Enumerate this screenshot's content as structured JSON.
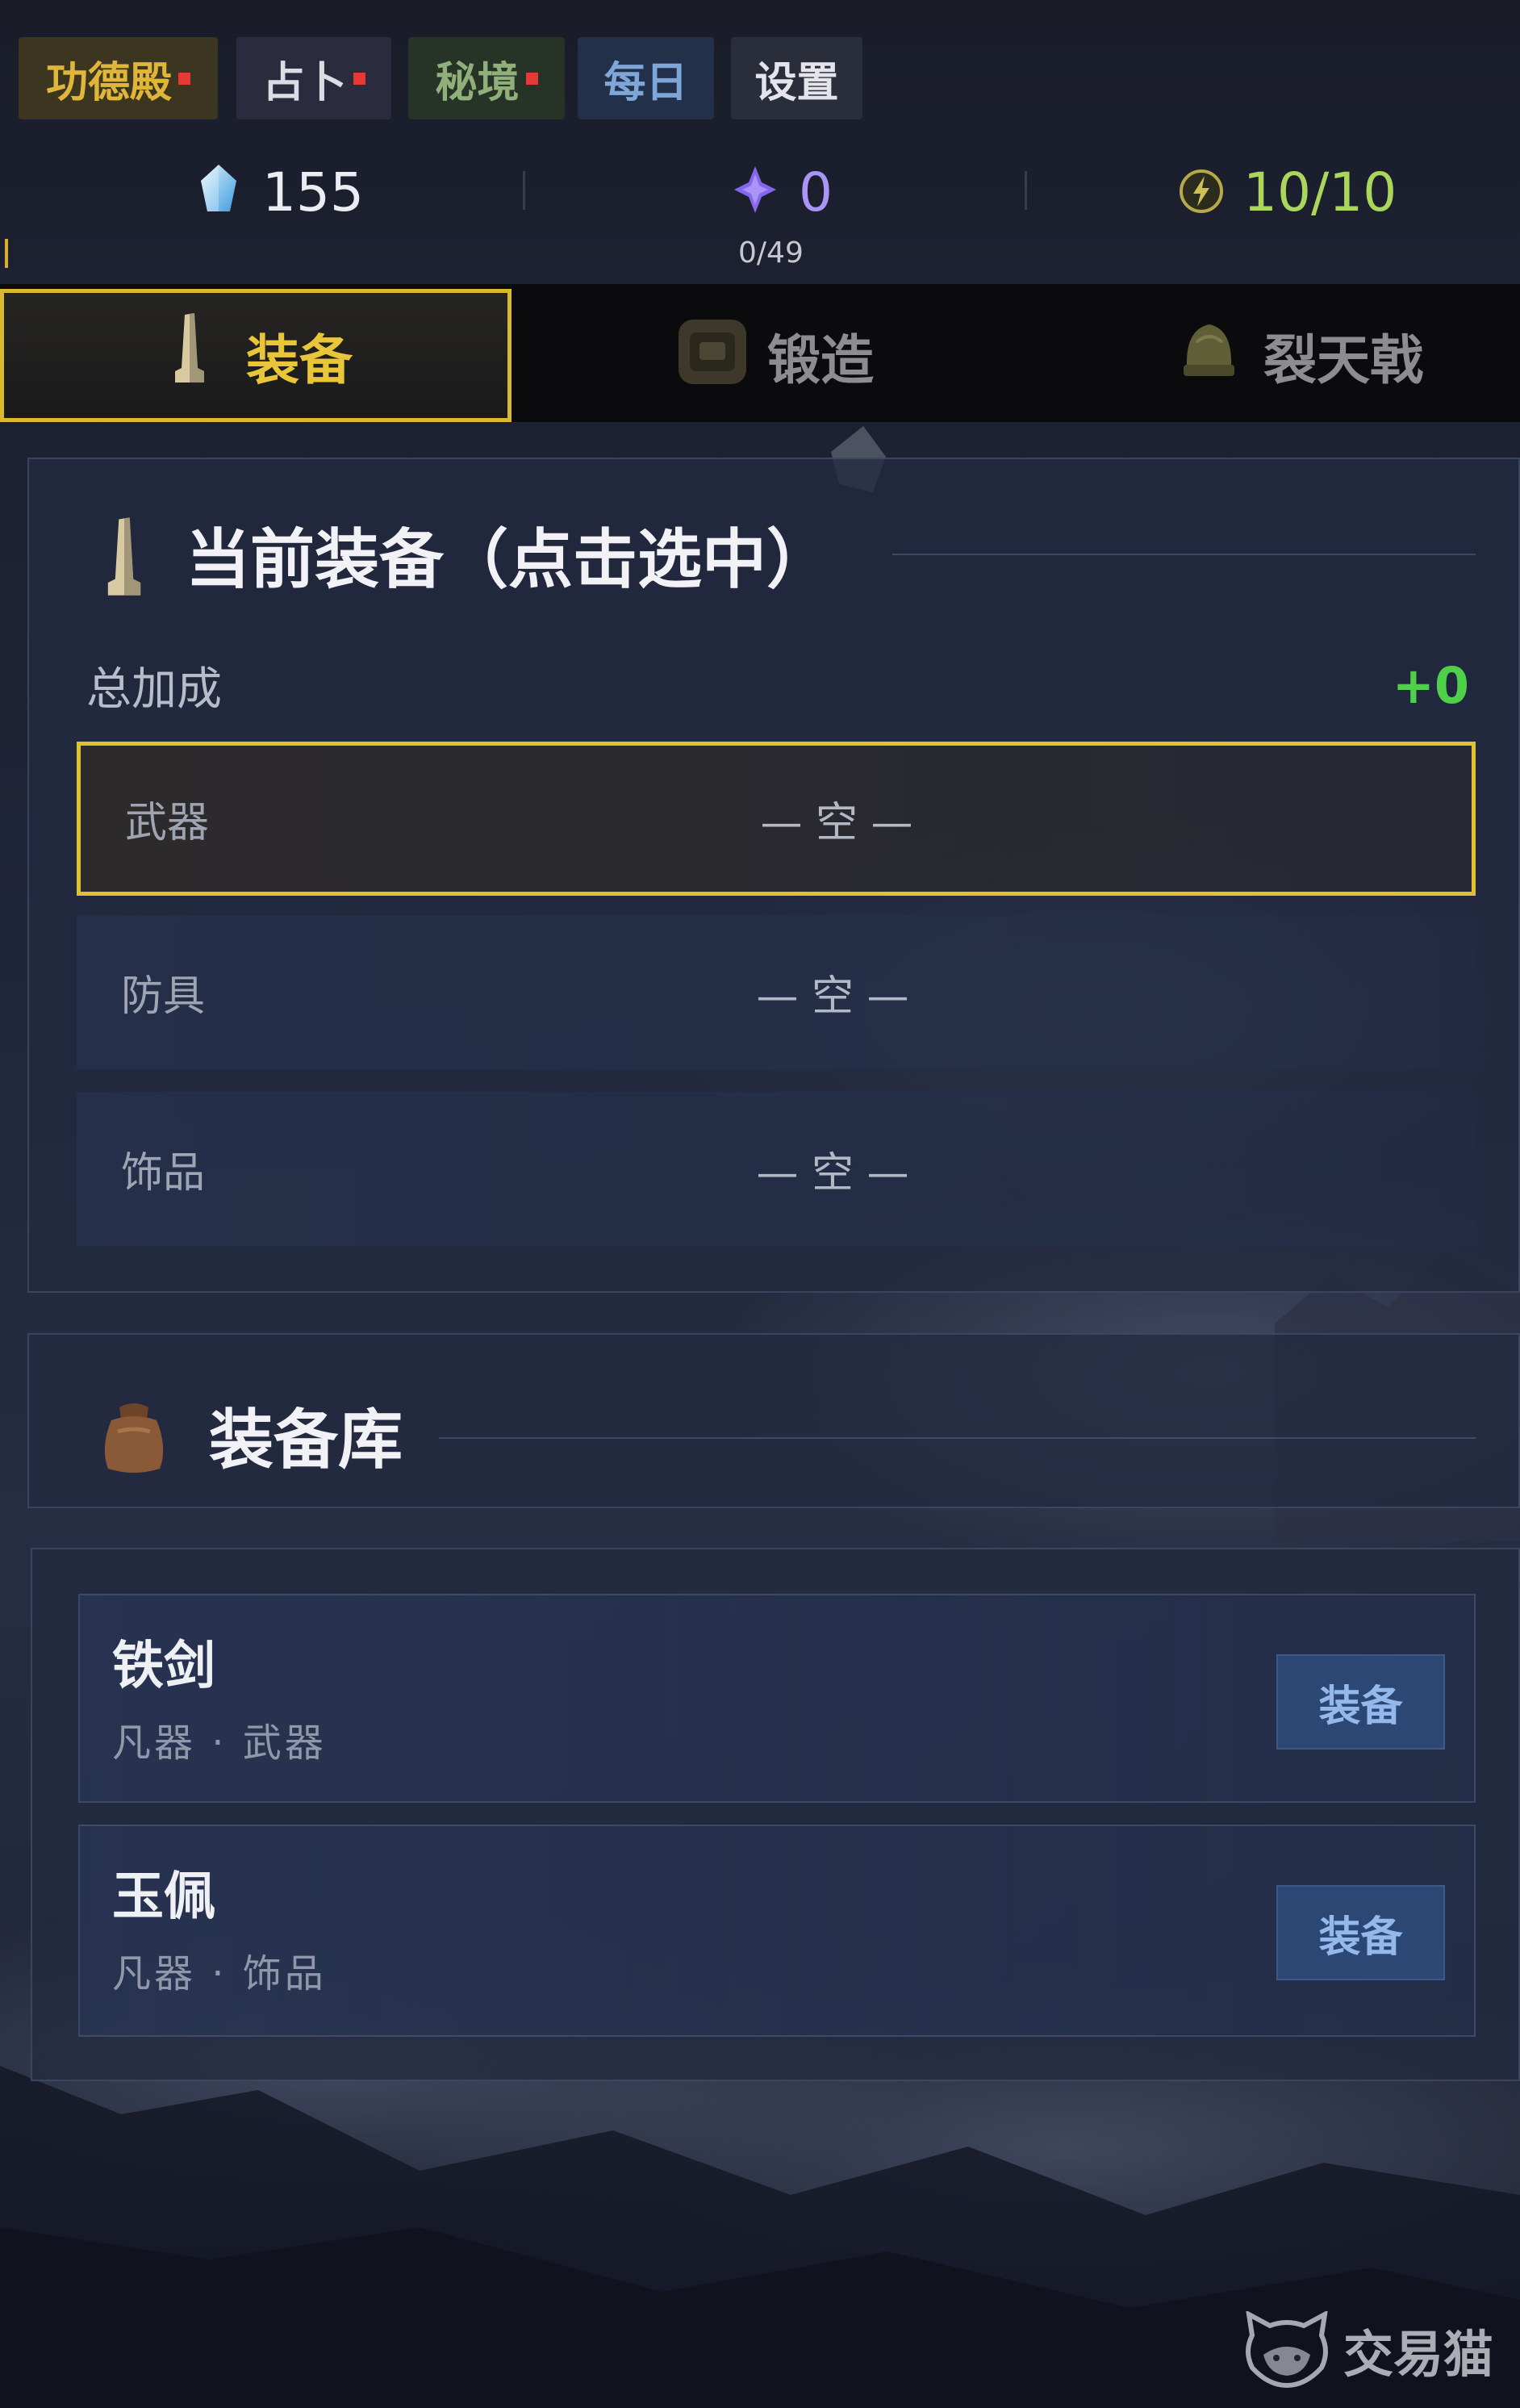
{
  "nav": {
    "items": [
      {
        "label": "功德殿",
        "badge": true,
        "color": "#e0b63a",
        "bg": "#3c3520"
      },
      {
        "label": "占卜",
        "badge": true,
        "color": "#dcdce4",
        "bg": "#2a2b3d"
      },
      {
        "label": "秘境",
        "badge": true,
        "color": "#8fb07a",
        "bg": "#283327"
      },
      {
        "label": "每日",
        "badge": false,
        "color": "#7fa6d8",
        "bg": "#23304a"
      },
      {
        "label": "设置",
        "badge": false,
        "color": "#e4e4ea",
        "bg": "#2a2d3a"
      }
    ]
  },
  "stats": {
    "crystal": {
      "icon": "crystal-icon",
      "value": "155",
      "color": "#ecedf3"
    },
    "gem": {
      "icon": "purple-gem-icon",
      "value": "0",
      "sub": "0/49",
      "color": "#a995f5"
    },
    "energy": {
      "icon": "lightning-icon",
      "value": "10/10",
      "color": "#a9d65b"
    }
  },
  "tabs": [
    {
      "label": "装备",
      "icon": "stele-icon",
      "selected": true,
      "color": "#e9c53a"
    },
    {
      "label": "锻造",
      "icon": "forge-icon",
      "selected": false,
      "color": "#8c8c91"
    },
    {
      "label": "裂天戟",
      "icon": "helmet-icon",
      "selected": false,
      "color": "#8c8c91"
    }
  ],
  "current": {
    "title": "当前装备（点击选中）",
    "icon": "stele-icon",
    "bonus_label": "总加成",
    "bonus_value": "+0",
    "bonus_color": "#4fd04a",
    "slots": [
      {
        "label": "武器",
        "value": "— 空 —",
        "selected": true
      },
      {
        "label": "防具",
        "value": "— 空 —",
        "selected": false
      },
      {
        "label": "饰品",
        "value": "— 空 —",
        "selected": false
      }
    ]
  },
  "inventory": {
    "title": "装备库",
    "icon": "bag-icon",
    "items": [
      {
        "name": "铁剑",
        "meta": "凡器 · 武器",
        "action": "装备"
      },
      {
        "name": "玉佩",
        "meta": "凡器 · 饰品",
        "action": "装备"
      }
    ]
  },
  "watermark": {
    "icon": "cat-logo-icon",
    "text": "交易猫"
  },
  "colors": {
    "accent_gold": "#d9b92e",
    "badge_red": "#e53935",
    "button_blue": "#2c4773",
    "panel_bg": "#222a40"
  }
}
